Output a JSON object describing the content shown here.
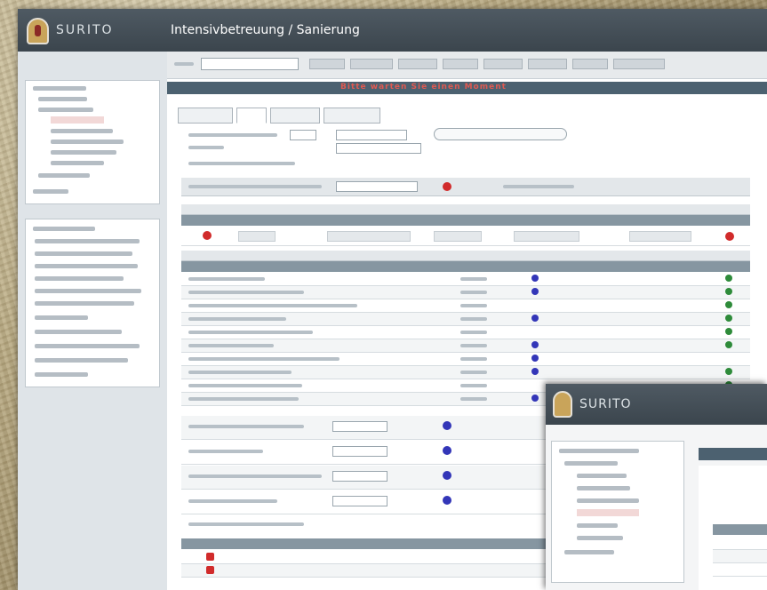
{
  "window": {
    "brand": "SURITO",
    "title": "Intensivbetreuung / Sanierung"
  },
  "alert": "Bitte warten Sie einen Moment",
  "secondary_window": {
    "brand": "SURITO"
  },
  "colors": {
    "titlebar": "#444f57",
    "accent_red": "#d12b2b",
    "status_blue": "#3336b8",
    "status_green": "#2e8b3a",
    "table_header": "#8696a1"
  },
  "icons": [
    "logo-shield-icon",
    "status-red-dot-icon",
    "status-blue-dot-icon",
    "status-green-dot-icon"
  ]
}
